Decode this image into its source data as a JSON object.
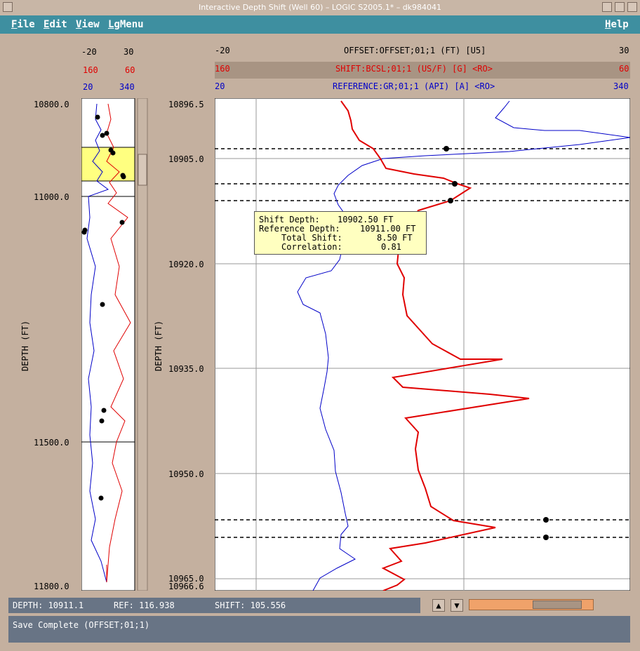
{
  "window": {
    "title": "Interactive Depth Shift (Well 60) – LOGIC S2005.1* – dk984041"
  },
  "menu": {
    "file": {
      "first": "F",
      "rest": "ile"
    },
    "edit": {
      "first": "E",
      "rest": "dit"
    },
    "view": {
      "first": "V",
      "rest": "iew"
    },
    "lgmenu": {
      "first": "L",
      "rest": "gMenu"
    },
    "help": {
      "first": "H",
      "rest": "elp"
    }
  },
  "overview": {
    "offset_min": "-20",
    "offset_max": "30",
    "shift_min": "160",
    "shift_max": "60",
    "ref_min": "20",
    "ref_max": "340",
    "depth_ticks": [
      "10800.0",
      "11000.0",
      "11500.0",
      "11800.0"
    ],
    "axis_label": "DEPTH (FT)"
  },
  "main": {
    "offset_title": "OFFSET:OFFSET;01;1 (FT) [U5]",
    "offset_min": "-20",
    "offset_max": "30",
    "shift_title": "SHIFT:BCSL;01;1 (US/F) [G] <RO>",
    "shift_min": "160",
    "shift_max": "60",
    "ref_title": "REFERENCE:GR;01;1 (API) [A] <RO>",
    "ref_min": "20",
    "ref_max": "340",
    "depth_ticks": [
      "10896.5",
      "10905.0",
      "10920.0",
      "10935.0",
      "10950.0",
      "10965.0",
      "10966.6"
    ],
    "axis_label": "DEPTH (FT)"
  },
  "tooltip": {
    "shift_depth_label": "Shift Depth:",
    "shift_depth_value": "10902.50 FT",
    "ref_depth_label": "Reference Depth:",
    "ref_depth_value": "10911.00 FT",
    "total_shift_label": "Total Shift:",
    "total_shift_value": "8.50 FT",
    "correlation_label": "Correlation:",
    "correlation_value": "0.81"
  },
  "status": {
    "depth": "DEPTH: 10911.1",
    "ref": "REF: 116.938",
    "shift": "SHIFT: 105.556",
    "message": "Save Complete (OFFSET;01;1)"
  },
  "buttons": {
    "up": "▲",
    "down": "▼"
  },
  "colors": {
    "shift_curve": "#e00000",
    "reference_curve": "#0000c8",
    "menubar": "#3e8fa0",
    "status": "#687485",
    "highlight": "#ffff80"
  }
}
